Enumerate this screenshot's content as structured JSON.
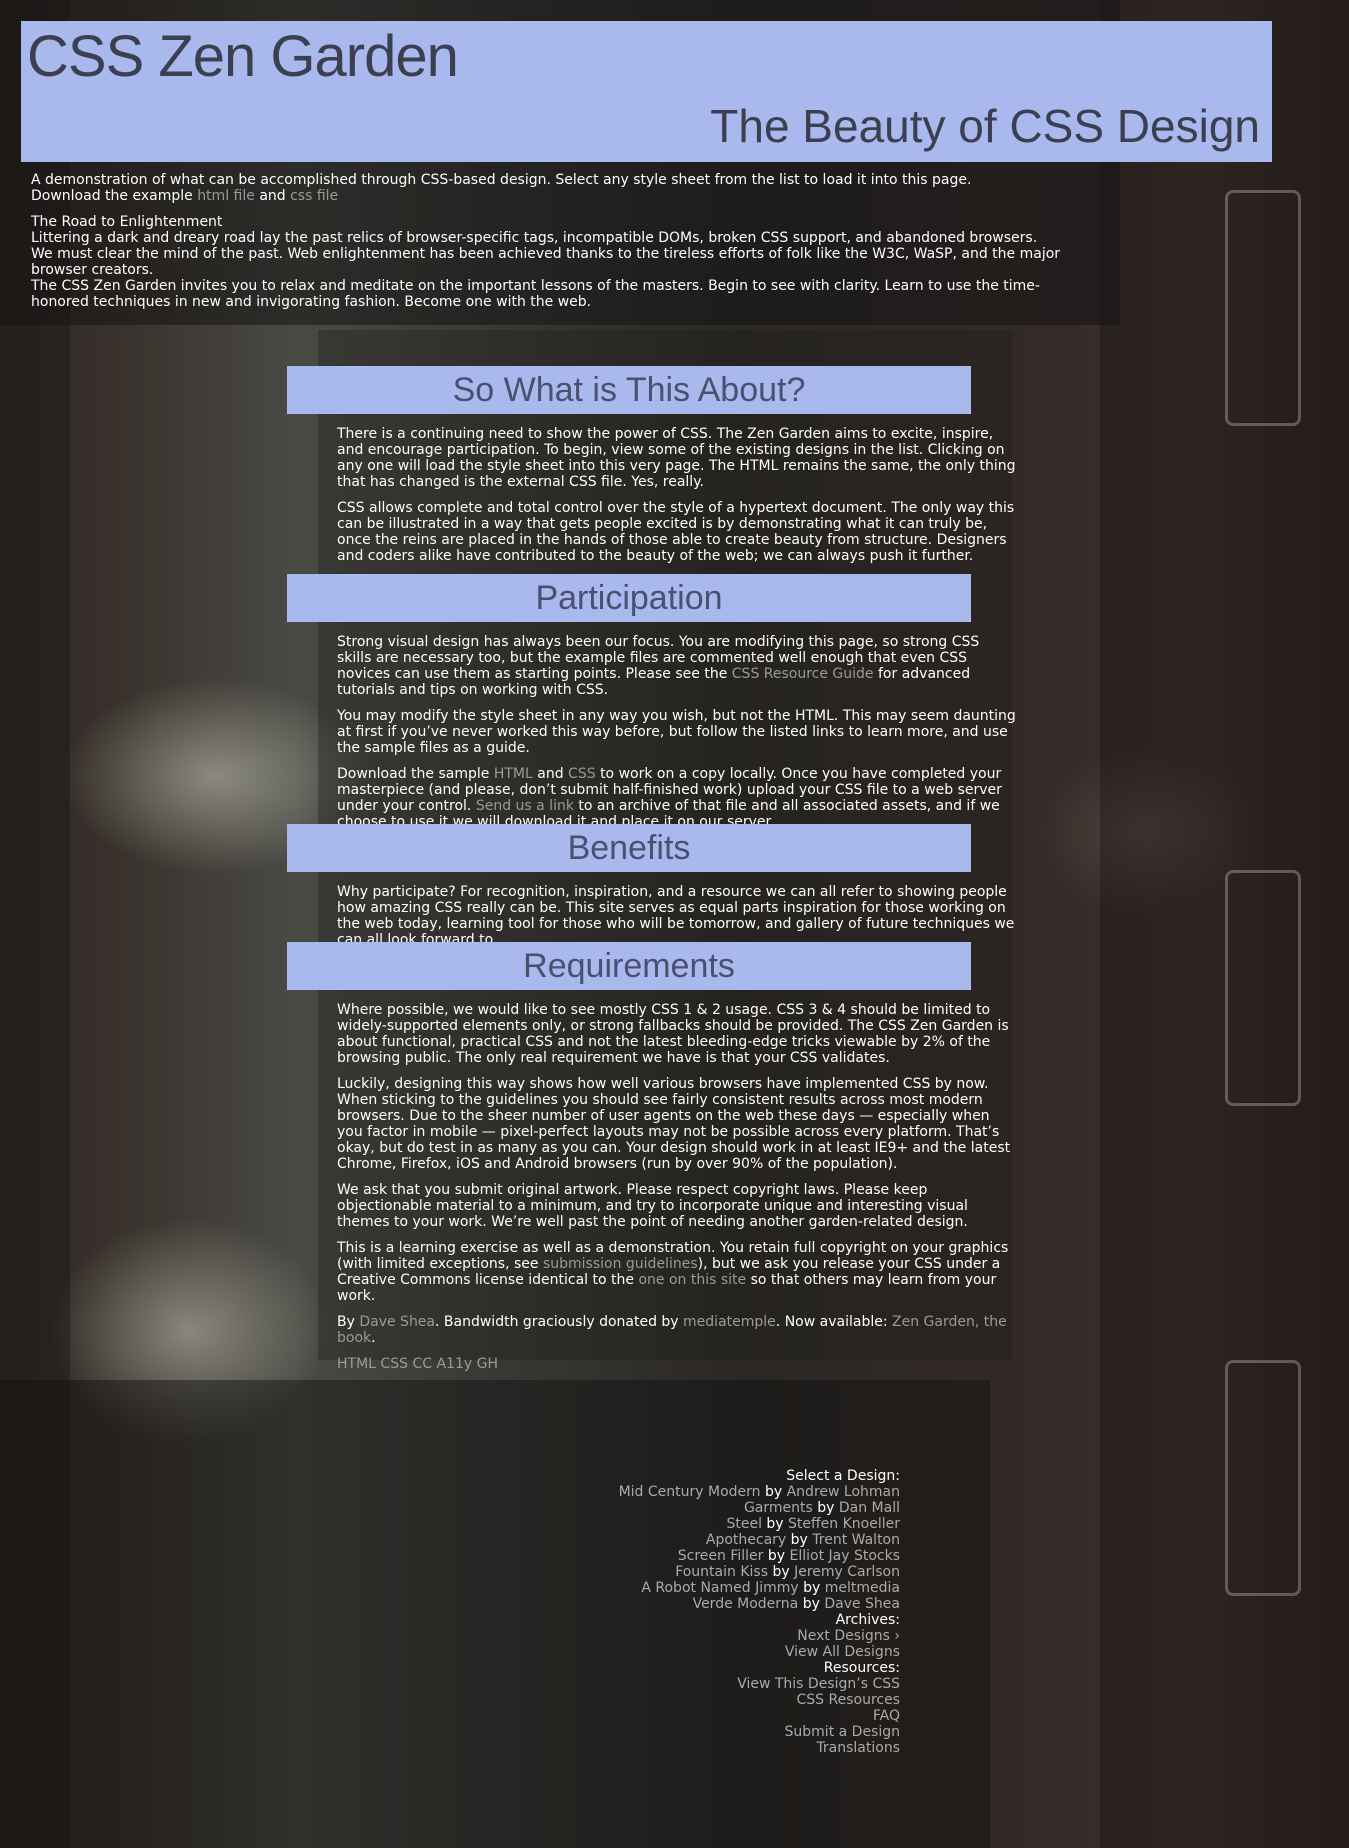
{
  "header": {
    "title": "CSS Zen Garden",
    "subtitle": "The Beauty of CSS Design"
  },
  "intro": {
    "summary": "A demonstration of what can be accomplished through CSS-based design. Select any style sheet from the list to load it into this page.",
    "download_prefix": "Download the example",
    "html_file": "html file",
    "and": "and",
    "css_file": "css file",
    "preamble_title": "The Road to Enlightenment",
    "p1": "Littering a dark and dreary road lay the past relics of browser-specific tags, incompatible DOMs, broken CSS support, and abandoned browsers.",
    "p2": "We must clear the mind of the past. Web enlightenment has been achieved thanks to the tireless efforts of folk like the W3C, WaSP, and the major browser creators.",
    "p3": "The CSS Zen Garden invites you to relax and meditate on the important lessons of the masters. Begin to see with clarity. Learn to use the time-honored techniques in new and invigorating fashion. Become one with the web."
  },
  "explanation": {
    "title": "So What is This About?",
    "p1": "There is a continuing need to show the power of CSS. The Zen Garden aims to excite, inspire, and encourage participation. To begin, view some of the existing designs in the list. Clicking on any one will load the style sheet into this very page. The HTML remains the same, the only thing that has changed is the external CSS file. Yes, really.",
    "p2": "CSS allows complete and total control over the style of a hypertext document. The only way this can be illustrated in a way that gets people excited is by demonstrating what it can truly be, once the reins are placed in the hands of those able to create beauty from structure. Designers and coders alike have contributed to the beauty of the web; we can always push it further."
  },
  "participation": {
    "title": "Participation",
    "p1_a": "Strong visual design has always been our focus. You are modifying this page, so strong CSS skills are necessary too, but the example files are commented well enough that even CSS novices can use them as starting points. Please see the",
    "p1_link": "CSS Resource Guide",
    "p1_b": "for advanced tutorials and tips on working with CSS.",
    "p2": "You may modify the style sheet in any way you wish, but not the HTML. This may seem daunting at first if you’ve never worked this way before, but follow the listed links to learn more, and use the sample files as a guide.",
    "p3_a": "Download the sample",
    "p3_html": "HTML",
    "p3_and": "and",
    "p3_css": "CSS",
    "p3_b": "to work on a copy locally. Once you have completed your masterpiece (and please, don’t submit half-finished work) upload your CSS file to a web server under your control.",
    "p3_link": "Send us a link",
    "p3_c": "to an archive of that file and all associated assets, and if we choose to use it we will download it and place it on our server."
  },
  "benefits": {
    "title": "Benefits",
    "p1": "Why participate? For recognition, inspiration, and a resource we can all refer to showing people how amazing CSS really can be. This site serves as equal parts inspiration for those working on the web today, learning tool for those who will be tomorrow, and gallery of future techniques we can all look forward to."
  },
  "requirements": {
    "title": "Requirements",
    "p1": "Where possible, we would like to see mostly CSS 1 & 2 usage. CSS 3 & 4 should be limited to widely-supported elements only, or strong fallbacks should be provided. The CSS Zen Garden is about functional, practical CSS and not the latest bleeding-edge tricks viewable by 2% of the browsing public. The only real requirement we have is that your CSS validates.",
    "p2": "Luckily, designing this way shows how well various browsers have implemented CSS by now. When sticking to the guidelines you should see fairly consistent results across most modern browsers. Due to the sheer number of user agents on the web these days — especially when you factor in mobile — pixel-perfect layouts may not be possible across every platform. That’s okay, but do test in as many as you can. Your design should work in at least IE9+ and the latest Chrome, Firefox, iOS and Android browsers (run by over 90% of the population).",
    "p3": "We ask that you submit original artwork. Please respect copyright laws. Please keep objectionable material to a minimum, and try to incorporate unique and interesting visual themes to your work. We’re well past the point of needing another garden-related design.",
    "p4_a": "This is a learning exercise as well as a demonstration. You retain full copyright on your graphics (with limited exceptions, see",
    "p4_link1": "submission guidelines",
    "p4_b": "), but we ask you release your CSS under a Creative Commons license identical to the",
    "p4_link2": "one on this site",
    "p4_c": "so that others may learn from your work.",
    "by": "By",
    "author": "Dave Shea",
    "bandwidth": ". Bandwidth graciously donated by",
    "host": "mediatemple",
    "available": ". Now available:",
    "book": "Zen Garden, the book",
    "period": "."
  },
  "footer_links": [
    "HTML",
    "CSS",
    "CC",
    "A11y",
    "GH"
  ],
  "sidebar": {
    "select_title": "Select a Design:",
    "by": "by",
    "designs": [
      {
        "name": "Mid Century Modern",
        "author": "Andrew Lohman"
      },
      {
        "name": "Garments",
        "author": "Dan Mall"
      },
      {
        "name": "Steel",
        "author": "Steffen Knoeller"
      },
      {
        "name": "Apothecary",
        "author": "Trent Walton"
      },
      {
        "name": "Screen Filler",
        "author": "Elliot Jay Stocks"
      },
      {
        "name": "Fountain Kiss",
        "author": "Jeremy Carlson"
      },
      {
        "name": "A Robot Named Jimmy",
        "author": "meltmedia"
      },
      {
        "name": "Verde Moderna",
        "author": "Dave Shea"
      }
    ],
    "archives_title": "Archives:",
    "next_designs": "Next Designs ›",
    "view_all": "View All Designs",
    "resources_title": "Resources:",
    "resources": [
      "View This Design’s CSS",
      "CSS Resources",
      "FAQ",
      "Submit a Design",
      "Translations"
    ]
  },
  "colors": {
    "accent": "#a9b9ee",
    "heading_text": "#3b3f4f",
    "link": "#9a9a9a"
  }
}
